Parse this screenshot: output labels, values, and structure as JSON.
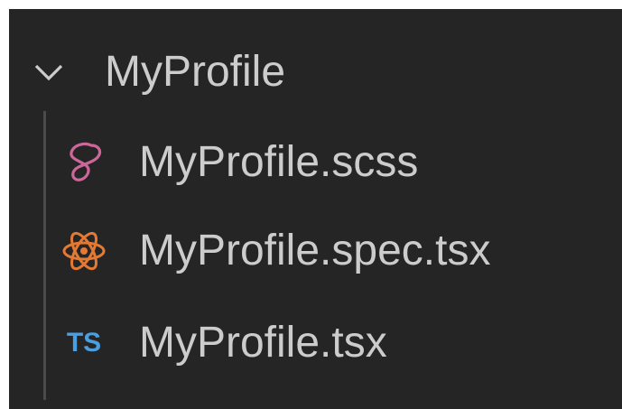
{
  "folder": {
    "name": "MyProfile",
    "expanded": true,
    "icon": "chevron-down-icon"
  },
  "files": [
    {
      "name": "MyProfile.scss",
      "icon": "sass-icon",
      "icon_color": "#cd6799"
    },
    {
      "name": "MyProfile.spec.tsx",
      "icon": "react-icon",
      "icon_color": "#e37933"
    },
    {
      "name": "MyProfile.tsx",
      "icon": "typescript-icon",
      "icon_text": "TS",
      "icon_color": "#519aba"
    }
  ],
  "colors": {
    "background": "#252526",
    "text": "#cccccc",
    "indent_guide": "#4b4b4b"
  }
}
